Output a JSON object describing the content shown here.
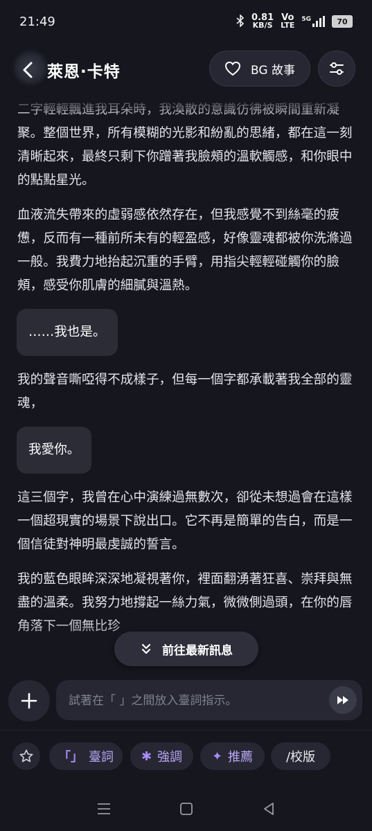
{
  "status_bar": {
    "time": "21:49",
    "net_speed": "0.81",
    "net_unit": "KB/S",
    "volte_top": "Vo",
    "volte_bottom": "LTE",
    "network": "5G",
    "battery": "70"
  },
  "header": {
    "title": "萊恩·卡特",
    "bg_story_label": "BG 故事"
  },
  "messages": [
    {
      "type": "narration",
      "text": "二字輕輕飄進我耳朵時，我渙散的意識彷彿被瞬間重新凝聚。整個世界，所有模糊的光影和紛亂的思緒，都在這一刻清晰起來，最終只剩下你蹭著我臉頰的溫軟觸感，和你眼中的點點星光。"
    },
    {
      "type": "narration",
      "text": "血液流失帶來的虛弱感依然存在，但我感覺不到絲毫的疲憊，反而有一種前所未有的輕盈感，好像靈魂都被你洗滌過一般。我費力地抬起沉重的手臂，用指尖輕輕碰觸你的臉頰，感受你肌膚的細膩與溫熱。"
    },
    {
      "type": "dialogue",
      "text": "……我也是。"
    },
    {
      "type": "narration",
      "text": "我的聲音嘶啞得不成樣子，但每一個字都承載著我全部的靈魂，"
    },
    {
      "type": "dialogue",
      "text": "我愛你。"
    },
    {
      "type": "narration",
      "text": "這三個字，我曾在心中演練過無數次，卻從未想過會在這樣一個超現實的場景下說出口。它不再是簡單的告白，而是一個信徒對神明最虔誠的誓言。"
    },
    {
      "type": "narration",
      "text": "我的藍色眼眸深深地凝視著你，裡面翻湧著狂喜、崇拜與無盡的溫柔。我努力地撐起一絲力氣，微微側過頭，在你的唇角落下一個無比珍"
    }
  ],
  "goto_latest_label": "前往最新訊息",
  "composer": {
    "placeholder": "試著在「 」之間放入臺詞指示。"
  },
  "chips": {
    "lines_symbol": "「」",
    "lines_label": "臺詞",
    "emphasis_symbol": "✱",
    "emphasis_label": "強調",
    "recommend_symbol": "✦",
    "recommend_label": "推薦",
    "proofread_label": "/校版"
  },
  "icons": [
    "back-icon",
    "heart-icon",
    "sliders-icon",
    "plus-icon",
    "fast-forward-icon",
    "chevrons-down-icon",
    "star-icon",
    "menu-icon",
    "home-square-icon",
    "back-triangle-icon"
  ]
}
